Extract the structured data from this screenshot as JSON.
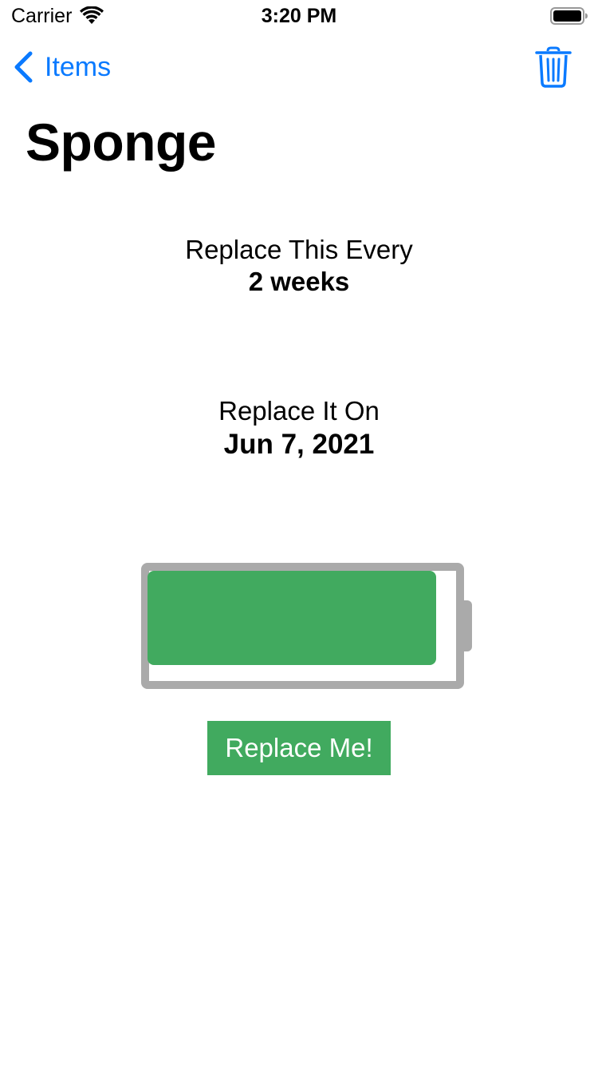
{
  "status_bar": {
    "carrier": "Carrier",
    "time": "3:20 PM",
    "wifi_icon": "wifi-icon",
    "battery_icon": "battery-full-icon"
  },
  "nav": {
    "back_label": "Items",
    "back_icon": "chevron-left-icon",
    "trash_icon": "trash-icon",
    "accent_color": "#0a7aff"
  },
  "page": {
    "title": "Sponge"
  },
  "frequency": {
    "label": "Replace This Every",
    "value": "2 weeks"
  },
  "replace_date": {
    "label": "Replace It On",
    "value": "Jun 7, 2021"
  },
  "battery": {
    "level": 1.0,
    "fill_color": "#41aa5f",
    "frame_color": "#aaaaaa"
  },
  "actions": {
    "replace_label": "Replace Me!",
    "replace_color": "#41aa5f"
  }
}
